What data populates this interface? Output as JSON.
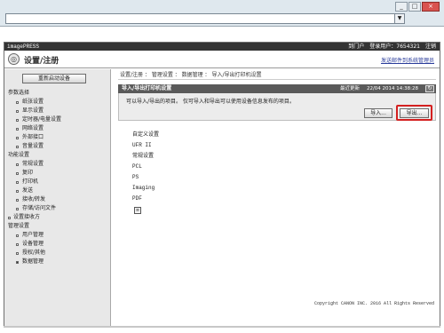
{
  "browser": {
    "win_buttons": [
      "_",
      "□",
      "×"
    ],
    "address_dropdown_symbol": "▼"
  },
  "topbar": {
    "brand": "imagePRESS",
    "portal_link": "到门户",
    "login_label": "登录用户：",
    "user_id": "7654321",
    "logout": "注销"
  },
  "header": {
    "logo_symbol": "◎",
    "title": "设置/注册",
    "help_link": "发送邮件到系统管理员"
  },
  "sidebar": {
    "restart_button": "重新启动设备",
    "sections": [
      {
        "heading": "参数选择",
        "items": [
          "纸张设置",
          "显示设置",
          "定时器/电量设置",
          "网络设置",
          "外部接口",
          "音量设置"
        ]
      },
      {
        "heading": "功能设置",
        "items": [
          "常规设置",
          "复印",
          "打印机",
          "发送",
          "接收/转发",
          "存储/访问文件"
        ]
      },
      {
        "heading": "",
        "solo_item": "设置接收方"
      },
      {
        "heading": "管理设置",
        "items": [
          "用户管理",
          "设备管理",
          "授权/其他",
          "数据管理"
        ]
      }
    ],
    "active_item": "数据管理"
  },
  "main": {
    "breadcrumb": "设置/注册 ： 管理设置 ： 数据管理 ： 导入/导出打印机设置",
    "panel": {
      "title": "导入/导出打印机设置",
      "updated_label": "最近更新",
      "updated_time": "22/04 2014 14:38:28",
      "refresh_symbol": "↻",
      "description": "可以导入/导出的项目。 仅可导入和导出可以使用设备信息发布的项目。",
      "import_button": "导入...",
      "export_button": "导出..."
    },
    "items": [
      "自定义设置",
      "UFR II",
      "常规设置",
      "PCL",
      "PS",
      "Imaging",
      "PDF"
    ],
    "page_icon_symbol": "≡"
  },
  "footer": {
    "copyright": "Copyright CANON INC. 2016 All Rights Reserved"
  }
}
